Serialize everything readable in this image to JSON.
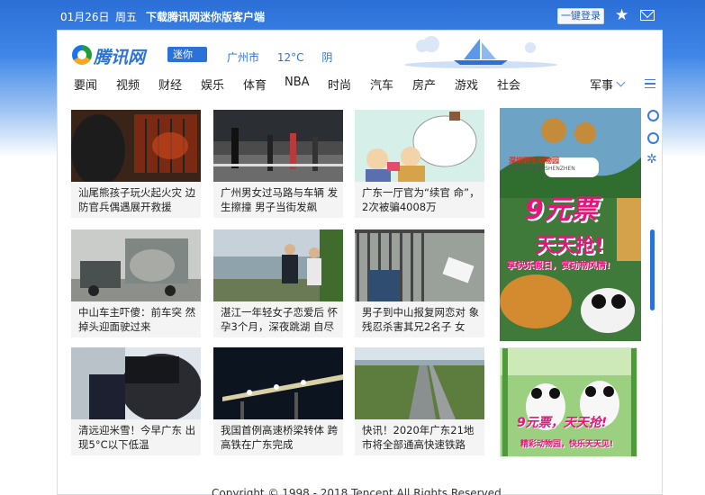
{
  "topbar": {
    "date": "01月26日",
    "weekday": "周五",
    "download": "下载腾讯网迷你版客户端",
    "login": "一键登录"
  },
  "header": {
    "logo_text": "腾讯网",
    "logo_badge": "迷你版",
    "city": "广州市",
    "temp": "12°C",
    "weather": "阴"
  },
  "nav": {
    "items": [
      "要闻",
      "视频",
      "财经",
      "娱乐",
      "体育",
      "NBA",
      "时尚",
      "汽车",
      "房产",
      "游戏",
      "社会"
    ],
    "more": "军事"
  },
  "news": [
    {
      "caption": "汕尾熊孩子玩火起火灾 边防官兵偶遇展开救援"
    },
    {
      "caption": "广州男女过马路与车辆 发生擦撞 男子当街发飙"
    },
    {
      "caption": "广东一厅官为“续官 命”，2次被骗4008万"
    },
    {
      "caption": "中山车主吓傻：前车突 然掉头迎面驶过来"
    },
    {
      "caption": "湛江一年轻女子恋爱后 怀孕3个月，深夜跳湖 自尽"
    },
    {
      "caption": "男子到中山报复网恋对 象 残忍杀害其兄2名子 女"
    },
    {
      "caption": "清远迎米雪！今早广东 出现5°C以下低温"
    },
    {
      "caption": "我国首例高速桥梁转体 跨高铁在广东完成"
    },
    {
      "caption": "快讯！2020年广东21地 市将全部通高快速铁路"
    }
  ],
  "ads": {
    "top": {
      "headline": "9元票",
      "slogan": "天天抢!",
      "sub": "享快乐假日，赏动物风情!",
      "park": "深圳野生动物园",
      "park_en": "SAFARI PARK SHENZHEN"
    },
    "bottom": {
      "headline": "9元票，天天抢!",
      "sub": "精彩动物园，快乐天天见!"
    }
  },
  "footer": "Copyright © 1998 - 2018 Tencent All Rights Reserved"
}
